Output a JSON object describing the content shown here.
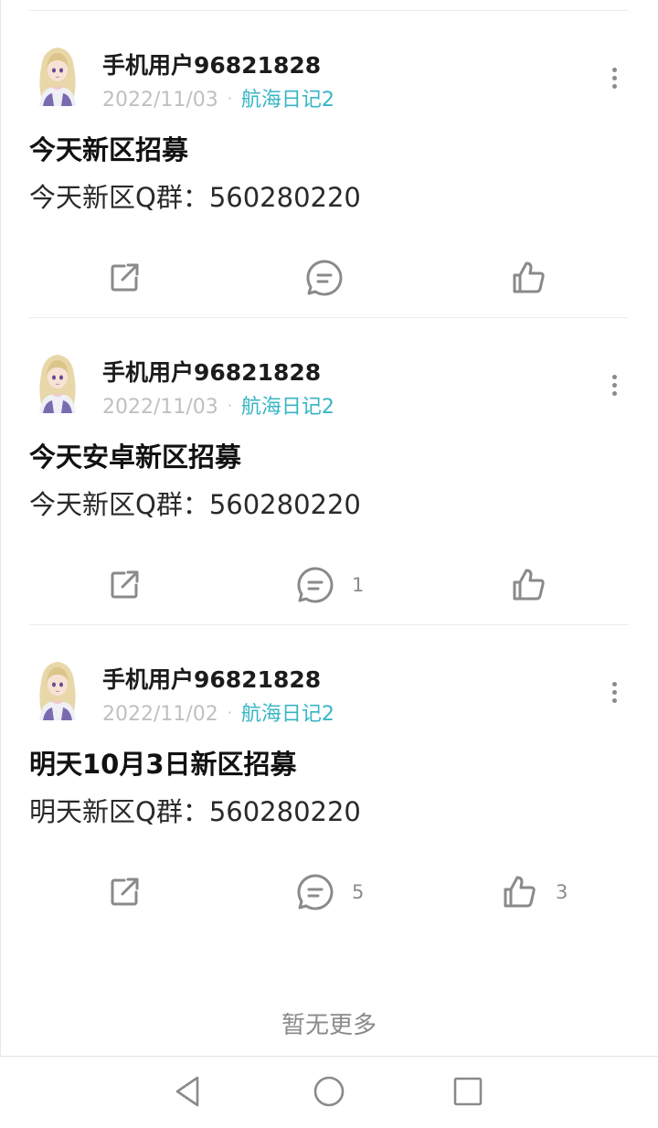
{
  "posts": [
    {
      "username": "手机用户96821828",
      "date": "2022/11/03",
      "game": "航海日记2",
      "title": "今天新区招募",
      "body": "今天新区Q群：560280220",
      "comment_count": "",
      "like_count": ""
    },
    {
      "username": "手机用户96821828",
      "date": "2022/11/03",
      "game": "航海日记2",
      "title": "今天安卓新区招募",
      "body": "今天新区Q群：560280220",
      "comment_count": "1",
      "like_count": ""
    },
    {
      "username": "手机用户96821828",
      "date": "2022/11/02",
      "game": "航海日记2",
      "title": "明天10月3日新区招募",
      "body": "明天新区Q群：560280220",
      "comment_count": "5",
      "like_count": "3"
    }
  ],
  "footer": {
    "no_more": "暂无更多"
  },
  "icons": {
    "share": "share-icon",
    "comment": "comment-icon",
    "like": "thumbs-up-icon",
    "more": "more-vertical-icon",
    "nav_back": "back-triangle-icon",
    "nav_home": "home-circle-icon",
    "nav_recents": "recents-square-icon"
  },
  "colors": {
    "accent": "#38b5c4",
    "muted": "#c0c0c0",
    "icon": "#8a8a8a"
  }
}
